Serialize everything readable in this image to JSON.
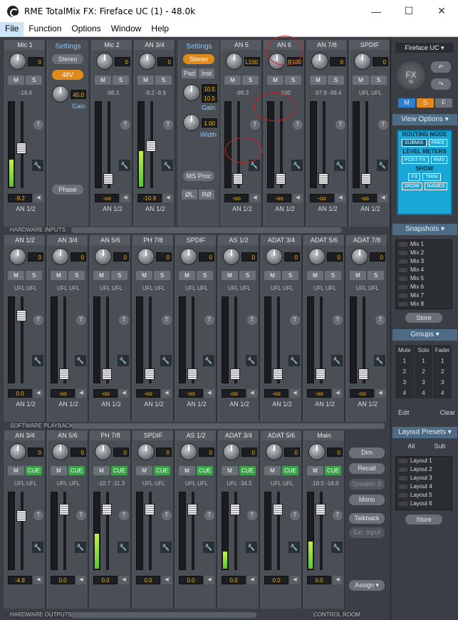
{
  "window": {
    "title": "RME TotalMix FX: Fireface UC (1) - 48.0k",
    "minimize": "—",
    "maximize": "☐",
    "close": "✕"
  },
  "menu": [
    "File",
    "Function",
    "Options",
    "Window",
    "Help"
  ],
  "inputs": {
    "section_label": "HARDWARE INPUTS",
    "channels": [
      {
        "name": "Mic 1",
        "gain": "0",
        "level": "-16.6",
        "vol": "-9.2",
        "route": "AN 1/2",
        "meter": 0.32,
        "fader": 0.45
      },
      {
        "name": "Mic 2",
        "gain": "0",
        "level": "-98.3",
        "vol": "-oo",
        "route": "AN 1/2",
        "meter": 0,
        "fader": 0.05
      },
      {
        "name": "AN 3/4",
        "gain": "0",
        "level": "-9.2 -8.9",
        "vol": "-10.9",
        "route": "AN 1/2",
        "meter": 0.42,
        "fader": 0.48
      },
      {
        "name": "AN 5",
        "gain": "L100",
        "level": "-99.3",
        "vol": "-oo",
        "route": "AN 1/2",
        "meter": 0,
        "fader": 0.05
      },
      {
        "name": "AN 6",
        "gain": "R100",
        "level": "-100",
        "vol": "-oo",
        "route": "AN 1/2",
        "meter": 0,
        "fader": 0.05
      },
      {
        "name": "AN 7/8",
        "gain": "0",
        "level": "-97.9 -99.4",
        "vol": "-oo",
        "route": "AN 1/2",
        "meter": 0,
        "fader": 0.05
      },
      {
        "name": "SPDIF",
        "gain": "0",
        "level": "UFL UFL",
        "vol": "-oo",
        "route": "AN 1/2",
        "meter": 0,
        "fader": 0.05
      }
    ],
    "settings1": {
      "title": "Settings",
      "stereo": "Stereo",
      "phantom": "48V",
      "gain_val": "45.0",
      "gain_label": "Gain",
      "phase": "Phase"
    },
    "settings2": {
      "title": "Settings",
      "stereo": "Stereo",
      "pad": "Pad",
      "inst": "Inst",
      "gain_val1": "10.5",
      "gain_val2": "10.5",
      "gain_label": "Gain",
      "width_val": "1.00",
      "width_label": "Width",
      "msproc": "MS Proc",
      "phase_l": "ØL",
      "phase_r": "RØ"
    }
  },
  "playback": {
    "section_label": "SOFTWARE PLAYBACK",
    "channels": [
      {
        "name": "AN 1/2",
        "gain": "0",
        "level": "UFL UFL",
        "vol": "0.0",
        "route": "AN 1/2",
        "fader": 0.82
      },
      {
        "name": "AN 3/4",
        "gain": "0",
        "level": "UFL UFL",
        "vol": "-oo",
        "route": "AN 1/2",
        "fader": 0.05
      },
      {
        "name": "AN 5/6",
        "gain": "0",
        "level": "UFL UFL",
        "vol": "-oo",
        "route": "AN 1/2",
        "fader": 0.05
      },
      {
        "name": "PH 7/8",
        "gain": "0",
        "level": "UFL UFL",
        "vol": "-oo",
        "route": "AN 1/2",
        "fader": 0.05
      },
      {
        "name": "SPDIF",
        "gain": "0",
        "level": "UFL UFL",
        "vol": "-oo",
        "route": "AN 1/2",
        "fader": 0.05
      },
      {
        "name": "AS 1/2",
        "gain": "0",
        "level": "UFL UFL",
        "vol": "-oo",
        "route": "AN 1/2",
        "fader": 0.05
      },
      {
        "name": "ADAT 3/4",
        "gain": "0",
        "level": "UFL UFL",
        "vol": "-oo",
        "route": "AN 1/2",
        "fader": 0.05
      },
      {
        "name": "ADAT 5/6",
        "gain": "0",
        "level": "UFL UFL",
        "vol": "-oo",
        "route": "AN 1/2",
        "fader": 0.05
      },
      {
        "name": "ADAT 7/8",
        "gain": "0",
        "level": "UFL UFL",
        "vol": "-oo",
        "route": "AN 1/2",
        "fader": 0.05
      }
    ]
  },
  "outputs": {
    "section_label": "HARDWARE OUTPUTS",
    "control_room": "CONTROL ROOM",
    "channels": [
      {
        "name": "AN 3/4",
        "gain": "0",
        "level": "UFL UFL",
        "vol": "-4.9",
        "meter": 0,
        "fader": 0.72
      },
      {
        "name": "AN 5/6",
        "gain": "0",
        "level": "UFL UFL",
        "vol": "0.0",
        "meter": 0,
        "fader": 0.82
      },
      {
        "name": "PH 7/8",
        "gain": "0",
        "level": "-10.7 -11.3",
        "vol": "0.0",
        "meter": 0.45,
        "fader": 0.82
      },
      {
        "name": "SPDIF",
        "gain": "0",
        "level": "UFL UFL",
        "vol": "0.0",
        "meter": 0,
        "fader": 0.82
      },
      {
        "name": "AS 1/2",
        "gain": "0",
        "level": "UFL UFL",
        "vol": "0.0",
        "meter": 0,
        "fader": 0.82
      },
      {
        "name": "ADAT 3/4",
        "gain": "0",
        "level": "UFL -34.5",
        "vol": "0.0",
        "meter": 0.22,
        "fader": 0.82
      },
      {
        "name": "ADAT 5/6",
        "gain": "0",
        "level": "UFL UFL",
        "vol": "0.0",
        "meter": 0,
        "fader": 0.82
      }
    ],
    "main": {
      "name": "Main",
      "gain": "0",
      "level": "-18.0 -18.8",
      "vol": "0.0",
      "meter": 0.35,
      "fader": 0.82
    },
    "cr_buttons": [
      "Dim",
      "Recall",
      "Speaker B",
      "Mono",
      "Talkback",
      "Ext. Input",
      "Assign ▾"
    ],
    "m_label": "M",
    "cue_label": "CUE"
  },
  "labels": {
    "m": "M",
    "s": "S",
    "t": "T",
    "wrench": "🔧",
    "arrow": "◀"
  },
  "sidebar": {
    "device": "Fireface UC",
    "fx": "FX",
    "fx_pct": "%",
    "msf": [
      "M",
      "S",
      "F"
    ],
    "view_options": {
      "title": "View Options",
      "routing_mode": "ROUTING MODE",
      "submix": "SUBMIX",
      "free": "FREE",
      "level_meters": "LEVEL METERS",
      "postfx": "POST FX",
      "rms": "RMS",
      "show": "SHOW",
      "fx_btn": "FX",
      "trim": "TRIM",
      "row2": "2ROW",
      "names": "NAMES"
    },
    "snapshots": {
      "title": "Snapshots",
      "items": [
        "Mix 1",
        "Mix 2",
        "Mix 3",
        "Mix 4",
        "Mix 5",
        "Mix 6",
        "Mix 7",
        "Mix 8"
      ],
      "store": "Store"
    },
    "groups": {
      "title": "Groups",
      "headers": [
        "Mute",
        "Solo",
        "Fader"
      ],
      "rows": [
        [
          "1",
          "1",
          "1"
        ],
        [
          "2",
          "2",
          "2"
        ],
        [
          "3",
          "3",
          "3"
        ],
        [
          "4",
          "4",
          "4"
        ]
      ],
      "edit": "Edit",
      "clear": "Clear"
    },
    "layout_presets": {
      "title": "Layout Presets",
      "all": "All",
      "sub": "Sub",
      "items": [
        "Layout 1",
        "Layout 2",
        "Layout 3",
        "Layout 4",
        "Layout 5",
        "Layout 6"
      ],
      "store": "Store"
    }
  }
}
